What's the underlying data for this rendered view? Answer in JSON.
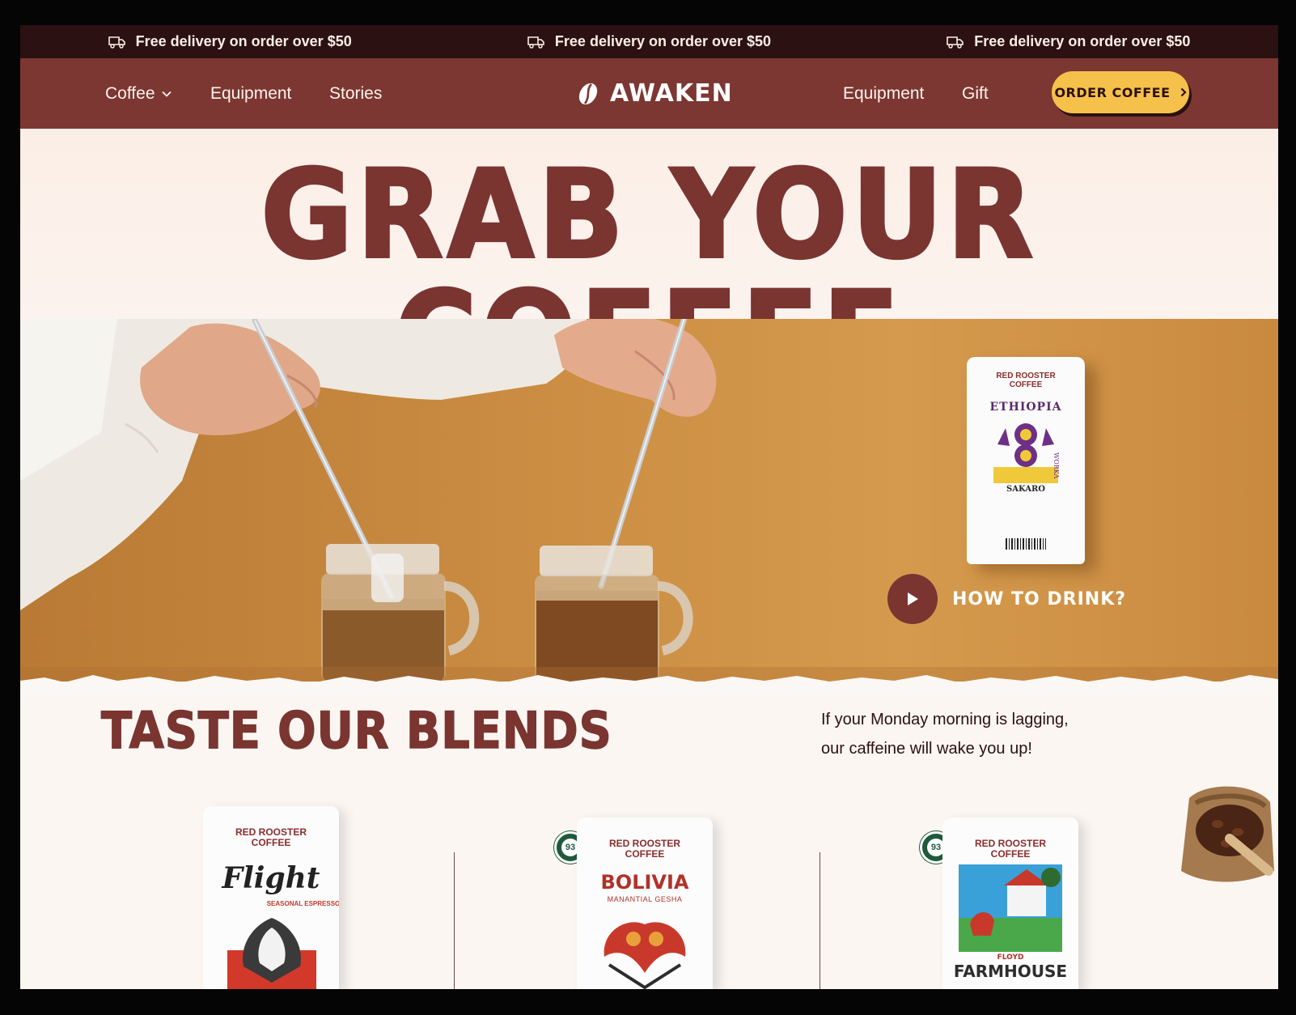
{
  "announcement": {
    "items": [
      "Free delivery on order over $50",
      "Free delivery on order over $50",
      "Free delivery on order over $50"
    ],
    "icon": "truck-icon"
  },
  "nav": {
    "left": [
      {
        "label": "Coffee",
        "has_dropdown": true
      },
      {
        "label": "Equipment"
      },
      {
        "label": "Stories"
      }
    ],
    "logo": "AWAKEN",
    "right": [
      {
        "label": "Equipment"
      },
      {
        "label": "Gift"
      }
    ],
    "cta": "ORDER COFFEE"
  },
  "hero": {
    "title": "GRAB YOUR COFFEE",
    "video_label": "HOW TO DRINK?",
    "product": {
      "brand_line1": "RED ROOSTER",
      "brand_line2": "COFFEE",
      "origin": "ETHIOPIA",
      "side_text": "WORKA",
      "name": "SAKARO"
    }
  },
  "blends": {
    "title": "TASTE OUR BLENDS",
    "description_line1": "If your Monday morning is lagging,",
    "description_line2": "our caffeine will wake you  up!",
    "products": [
      {
        "brand_line1": "RED ROOSTER",
        "brand_line2": "COFFEE",
        "name": "Flight",
        "subtitle": "SEASONAL ESPRESSO"
      },
      {
        "brand_line1": "RED ROOSTER",
        "brand_line2": "COFFEE",
        "name": "BOLIVIA",
        "subtitle": "MANANTIAL GESHA",
        "badge": "93"
      },
      {
        "brand_line1": "RED ROOSTER",
        "brand_line2": "COFFEE",
        "name": "FARMHOUSE",
        "subtitle": "FLOYD",
        "badge": "93"
      }
    ]
  },
  "colors": {
    "brand_brown": "#7a3531",
    "announce_bg": "#2b1111",
    "cta_yellow": "#f6c14a",
    "hero_bg": "#fbeee6"
  }
}
